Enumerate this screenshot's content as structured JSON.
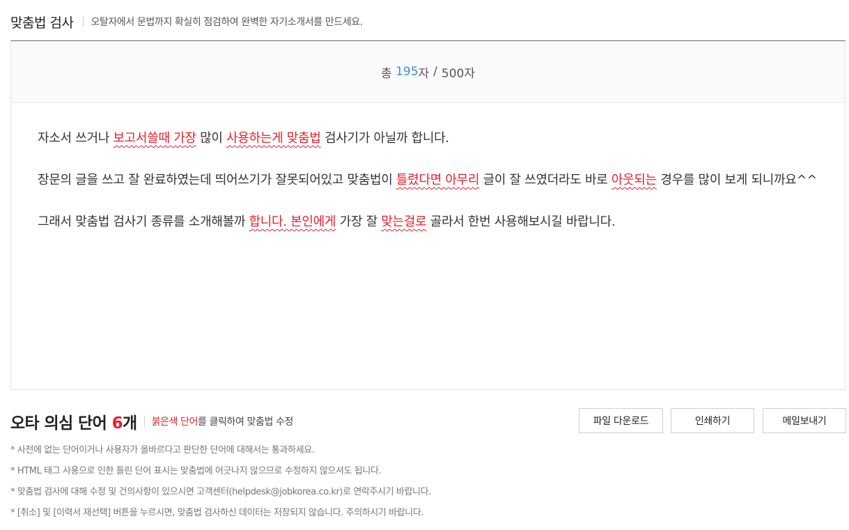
{
  "header": {
    "title": "맞춤법 검사",
    "subtitle": "오탈자에서 문법까지 확실히 점검하여 완벽한 자기소개서를 만드세요."
  },
  "counter": {
    "prefix": "총",
    "count": "195",
    "unit": "자",
    "slash": "/",
    "limit": "500자"
  },
  "content": {
    "p1": {
      "t1": "자소서 쓰거나 ",
      "e1": "보고서쓸때 가장",
      "t2": " 많이 ",
      "e2": "사용하는게 맞춤법",
      "t3": " 검사기가 아닐까 합니다."
    },
    "p2": {
      "t1": "장문의 글을 쓰고 잘 완료하였는데 띄어쓰기가 잘못되어있고 맞춤법이 ",
      "e1": "틀렸다면 아무리",
      "t2": " 글이 잘 쓰였더라도 바로 ",
      "e2": "아웃되는",
      "t3": " 경우를 많이 보게 되니까요^^"
    },
    "p3": {
      "t1": "그래서 맞춤법 검사기 종류를 소개해볼까 ",
      "e1": "합니다. 본인에게",
      "t2": " 가장 잘 ",
      "e2": "맞는걸로",
      "t3": " 골라서 한번 사용해보시길 바랍니다."
    }
  },
  "summary": {
    "title": "오타 의심 단어 ",
    "count": "6",
    "unit": "개",
    "desc_red": "붉은색 단어",
    "desc_rest": "를 클릭하여 맞춤법 수정"
  },
  "buttons": {
    "download": "파일 다운로드",
    "print": "인쇄하기",
    "email": "메일보내기"
  },
  "notes": [
    "* 사전에 없는 단어이거나 사용자가 올바르다고 판단한 단어에 대해서는 통과하세요.",
    "* HTML 태그 사용으로 인한 틀린 단어 표시는 맞춤법에 어긋나지 않으므로 수정하지 않으셔도 됩니다.",
    "* 맞춤법 검사에 대해 수정 및 건의사항이 있으시면 고객센터(helpdesk@jobkorea.co.kr)로 연락주시기 바랍니다.",
    "* [취소] 및 [이력서 재선택] 버튼을 누르시면, 맞춤법 검사하신 데이터는 저장되지 않습니다. 주의하시기 바랍니다."
  ],
  "colors": {
    "error": "#e5202d",
    "count_highlight": "#3b8ee8"
  }
}
